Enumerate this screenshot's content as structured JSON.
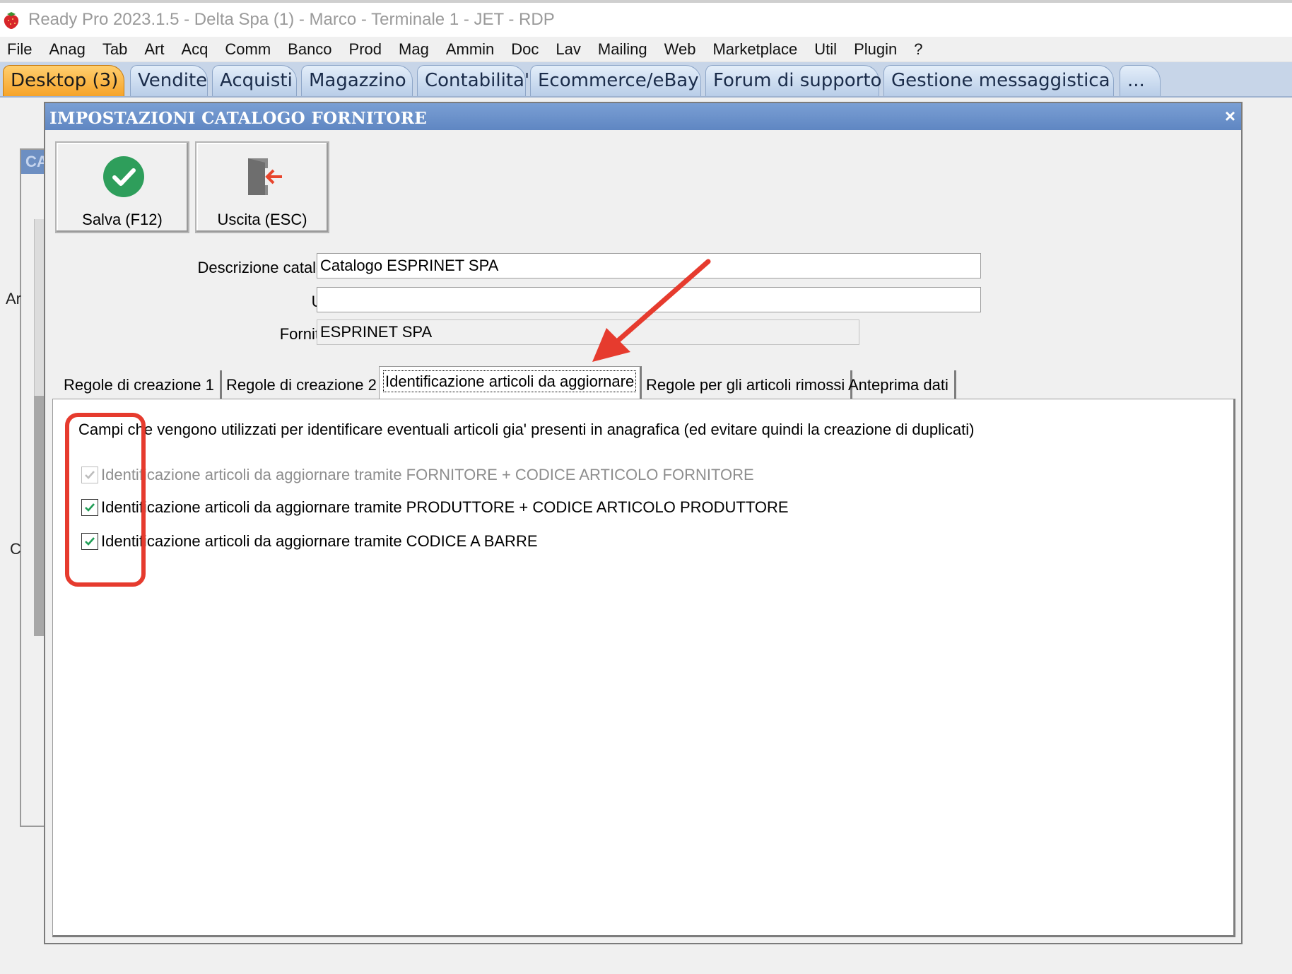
{
  "app": {
    "title": "Ready Pro 2023.1.5 - Delta Spa (1) - Marco - Terminale 1 - JET - RDP"
  },
  "menu": [
    "File",
    "Anag",
    "Tab",
    "Art",
    "Acq",
    "Comm",
    "Banco",
    "Prod",
    "Mag",
    "Ammin",
    "Doc",
    "Lav",
    "Mailing",
    "Web",
    "Marketplace",
    "Util",
    "Plugin",
    "?"
  ],
  "app_tabs": [
    "Desktop (3)",
    "Vendite",
    "Acquisti",
    "Magazzino",
    "Contabilita'",
    "Ecommerce/eBay",
    "Forum di supporto",
    "Gestione messaggistica",
    "..."
  ],
  "background_window": {
    "header": "CA",
    "label_1": "Ar",
    "label_2": "C"
  },
  "dialog": {
    "title": "IMPOSTAZIONI CATALOGO FORNITORE",
    "close": "×",
    "toolbar": {
      "save_label": "Salva (F12)",
      "exit_label": "Uscita (ESC)"
    },
    "fields": {
      "description_label": "Descrizione catalogo :",
      "description_value": "Catalogo ESPRINET SPA",
      "url_label": "URL :",
      "url_value": "",
      "supplier_label": "Fornitore :",
      "supplier_value": "ESPRINET SPA"
    },
    "tabs": [
      "Regole di creazione 1",
      "Regole di creazione 2",
      "Identificazione articoli da aggiornare",
      "Regole per gli articoli rimossi",
      "Anteprima dati"
    ],
    "active_tab": "Identificazione articoli da aggiornare",
    "panel": {
      "description": "Campi che vengono utilizzati per identificare eventuali articoli gia' presenti in anagrafica (ed evitare quindi la creazione di duplicati)",
      "options": [
        {
          "label": "Identificazione articoli da aggiornare tramite FORNITORE + CODICE ARTICOLO FORNITORE",
          "checked": true,
          "enabled": false
        },
        {
          "label": "Identificazione articoli da aggiornare tramite PRODUTTORE + CODICE ARTICOLO PRODUTTORE",
          "checked": true,
          "enabled": true
        },
        {
          "label": "Identificazione articoli da aggiornare tramite CODICE A BARRE",
          "checked": true,
          "enabled": true
        }
      ]
    }
  },
  "colors": {
    "title_bar": "#6d92cc",
    "active_tab": "#f6a42a",
    "annotation": "#e63b2e",
    "check": "#1f9d55"
  },
  "icons": {
    "app": "strawberry-icon",
    "save": "checkmark-circle-icon",
    "exit": "exit-door-icon"
  }
}
